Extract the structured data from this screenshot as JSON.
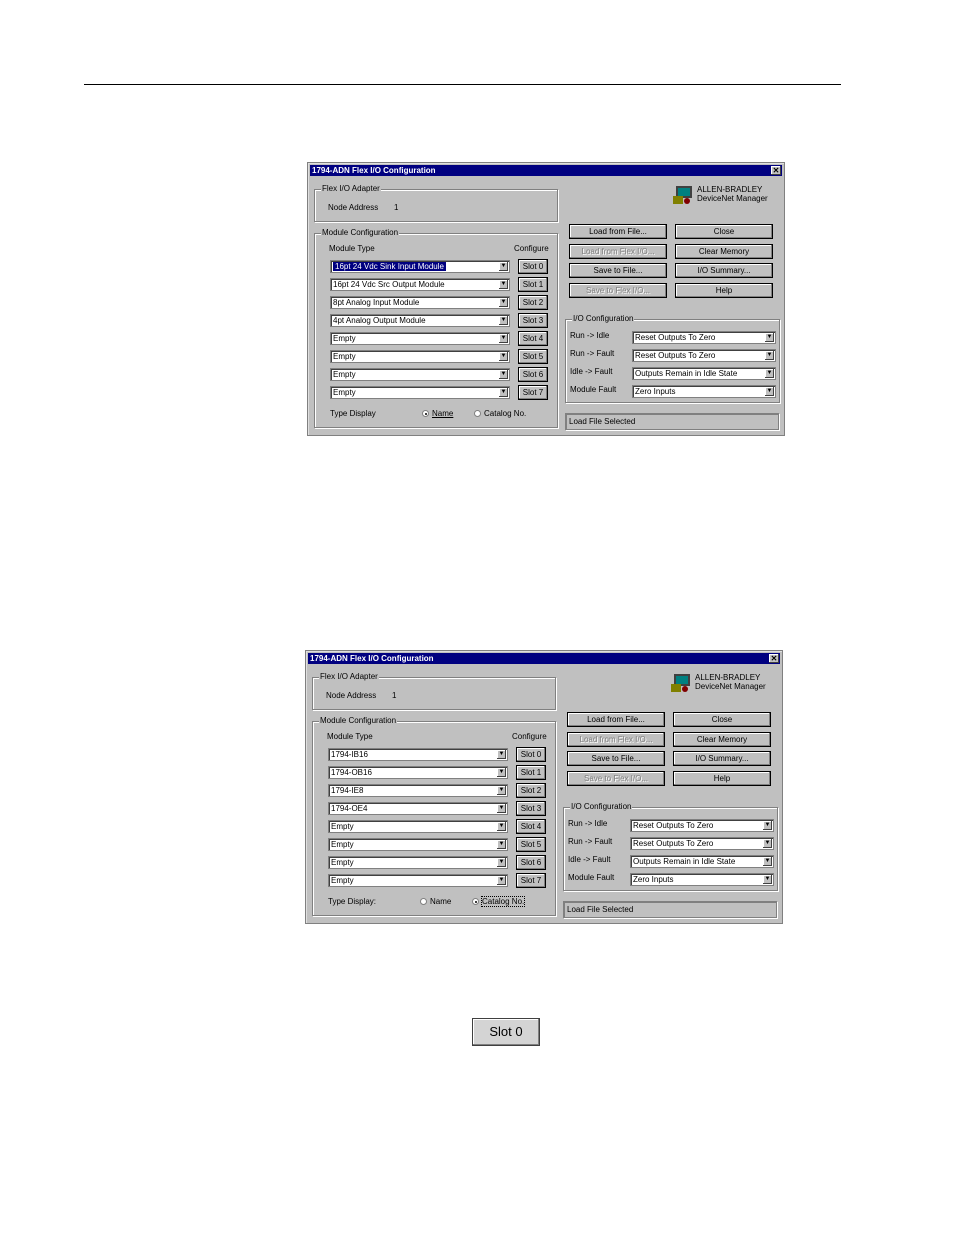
{
  "dialogs": [
    {
      "title": "1794-ADN Flex I/O Configuration",
      "adapter_group": "Flex I/O Adapter",
      "node_address_label": "Node Address",
      "node_address_value": "1",
      "vendor_line1": "ALLEN-BRADLEY",
      "vendor_line2": "DeviceNet Manager",
      "module_group": "Module Configuration",
      "module_type_header": "Module Type",
      "configure_header": "Configure",
      "modules": [
        "16pt 24 Vdc Sink Input Module",
        "16pt 24 Vdc Src Output Module",
        "8pt Analog Input Module",
        "4pt Analog Output Module",
        "Empty",
        "Empty",
        "Empty",
        "Empty"
      ],
      "slots": [
        "Slot 0",
        "Slot 1",
        "Slot 2",
        "Slot 3",
        "Slot 4",
        "Slot 5",
        "Slot 6",
        "Slot 7"
      ],
      "type_display_label": "Type Display",
      "radio_name": "Name",
      "radio_catalog": "Catalog No.",
      "selected_display": "name",
      "buttons": {
        "load_file": "Load from File...",
        "close": "Close",
        "load_device": "Load from Flex I/O...",
        "clear_memory": "Clear Memory",
        "save_file": "Save to File...",
        "io_summary": "I/O Summary...",
        "save_device": "Save to Flex I/O...",
        "help": "Help"
      },
      "io_group": "I/O Configuration",
      "io_rows": [
        {
          "label": "Run -> Idle",
          "value": "Reset Outputs To Zero"
        },
        {
          "label": "Run -> Fault",
          "value": "Reset Outputs To Zero"
        },
        {
          "label": "Idle -> Fault",
          "value": "Outputs Remain in Idle State"
        },
        {
          "label": "Module Fault",
          "value": "Zero Inputs"
        }
      ],
      "status": "Load File Selected"
    },
    {
      "title": "1794-ADN Flex I/O Configuration",
      "adapter_group": "Flex I/O Adapter",
      "node_address_label": "Node Address",
      "node_address_value": "1",
      "vendor_line1": "ALLEN-BRADLEY",
      "vendor_line2": "DeviceNet Manager",
      "module_group": "Module Configuration",
      "module_type_header": "Module Type",
      "configure_header": "Configure",
      "modules": [
        "1794-IB16",
        "1794-OB16",
        "1794-IE8",
        "1794-OE4",
        "Empty",
        "Empty",
        "Empty",
        "Empty"
      ],
      "slots": [
        "Slot 0",
        "Slot 1",
        "Slot 2",
        "Slot 3",
        "Slot 4",
        "Slot 5",
        "Slot 6",
        "Slot 7"
      ],
      "type_display_label": "Type Display:",
      "radio_name": "Name",
      "radio_catalog": "Catalog No.",
      "selected_display": "catalog",
      "buttons": {
        "load_file": "Load from File...",
        "close": "Close",
        "load_device": "Load from Flex I/O...",
        "clear_memory": "Clear Memory",
        "save_file": "Save to File...",
        "io_summary": "I/O Summary...",
        "save_device": "Save to Flex I/O...",
        "help": "Help"
      },
      "io_group": "I/O Configuration",
      "io_rows": [
        {
          "label": "Run -> Idle",
          "value": "Reset Outputs To Zero"
        },
        {
          "label": "Run -> Fault",
          "value": "Reset Outputs To Zero"
        },
        {
          "label": "Idle -> Fault",
          "value": "Outputs Remain in Idle State"
        },
        {
          "label": "Module Fault",
          "value": "Zero Inputs"
        }
      ],
      "status": "Load File Selected"
    }
  ],
  "standalone_button": "Slot 0"
}
